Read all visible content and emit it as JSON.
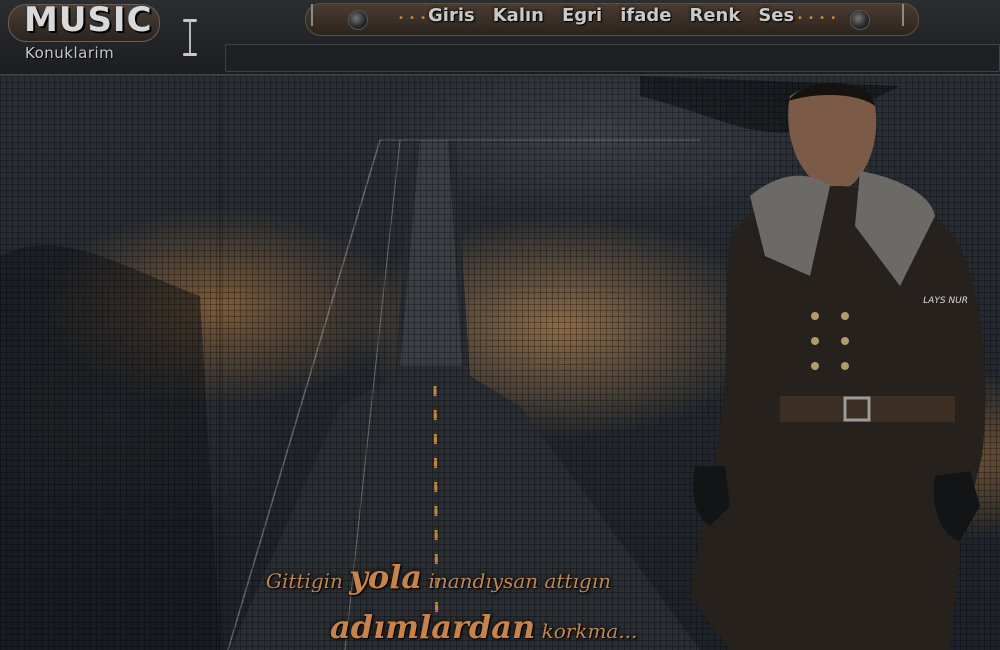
{
  "logo": {
    "title": "MUSIC",
    "subtitle": "Konuklarim"
  },
  "nav": {
    "items": [
      "Giris",
      "Kalın",
      "Egri",
      "ifade",
      "Renk",
      "Ses"
    ]
  },
  "quote": {
    "line1_pre": "Gittigin",
    "line1_big": "yola",
    "line1_post": "inandıysan attıgın",
    "line2_big": "adımlardan",
    "line2_post": "korkma..."
  },
  "watermark": "LAYS NUR",
  "colors": {
    "accent": "#c8834a",
    "nav_text": "#c9c9c9",
    "bar_bg": "#1e2124"
  }
}
